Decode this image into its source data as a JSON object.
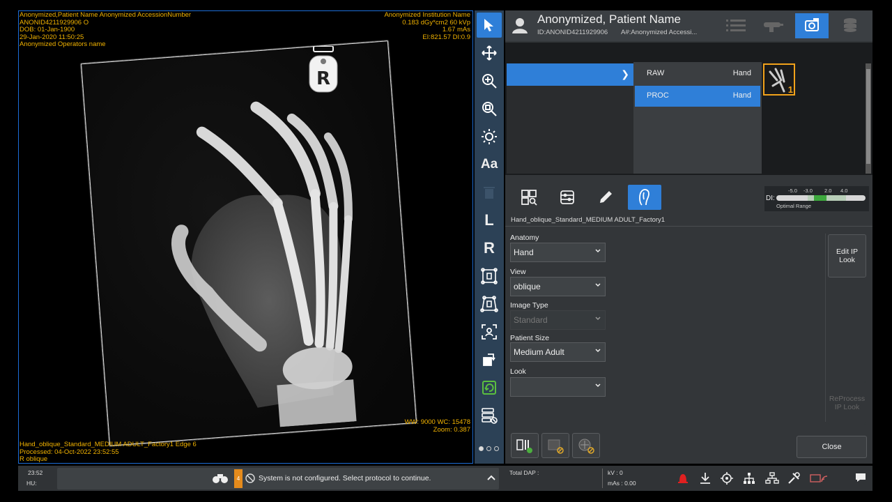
{
  "viewer": {
    "overlay_top_left": [
      "Anonymized,Patient Name Anonymized AccessionNumber",
      "ANONID4211929906 O",
      "DOB: 01-Jan-1900",
      "29-Jan-2020    11:50:25",
      "Anonymized Operators name"
    ],
    "overlay_top_right": [
      "Anonymized Institution Name",
      "0.183 dGy*cm2   60 kVp",
      "1.67 mAs",
      "EI:821.57 DI:0.9"
    ],
    "overlay_bottom_right": [
      "WW: 9000 WC: 15478",
      "Zoom: 0.387"
    ],
    "overlay_bottom_left": [
      "Hand_oblique_Standard_MEDIUM ADULT_Factory1 Edge 6",
      "Processed: 04-Oct-2022  23:52:55",
      "R oblique"
    ],
    "marker_letter": "R"
  },
  "toolstrip": {
    "tools": [
      {
        "name": "select-arrow-icon",
        "active": true
      },
      {
        "name": "pan-icon"
      },
      {
        "name": "zoom-in-icon"
      },
      {
        "name": "zoom-fit-icon"
      },
      {
        "name": "brightness-icon"
      },
      {
        "name": "annotation-text-icon",
        "label": "Aa"
      },
      {
        "name": "trash-icon"
      },
      {
        "name": "left-marker-icon",
        "label": "L"
      },
      {
        "name": "right-marker-icon",
        "label": "R"
      },
      {
        "name": "crop-icon"
      },
      {
        "name": "shutter-icon"
      },
      {
        "name": "face-detect-icon"
      },
      {
        "name": "rotate-icon"
      },
      {
        "name": "reset-icon"
      },
      {
        "name": "send-icon"
      }
    ]
  },
  "patient": {
    "name": "Anonymized, Patient Name",
    "id": "ID:ANONID4211929906",
    "accession": "A#:Anonymized Accessi..."
  },
  "header_buttons": [
    "worklist-icon",
    "tube-icon",
    "image-viewer-icon",
    "database-icon"
  ],
  "series": {
    "rows": [
      {
        "label": "RAW",
        "anatomy": "Hand",
        "selected": false
      },
      {
        "label": "PROC",
        "anatomy": "Hand",
        "selected": true
      }
    ],
    "thumbnail_count": "1"
  },
  "di_indicator": {
    "label": "DI:",
    "scale": [
      "-5.0",
      "-3.0",
      "2.0",
      "4.0"
    ],
    "optimal_label": "Optimal Range",
    "value_color": "#3da83d"
  },
  "protocol_name": "Hand_oblique_Standard_MEDIUM ADULT_Factory1",
  "fields": {
    "anatomy": {
      "label": "Anatomy",
      "value": "Hand"
    },
    "view": {
      "label": "View",
      "value": "oblique"
    },
    "image_type": {
      "label": "Image Type",
      "value": "Standard",
      "disabled": true
    },
    "patient_size": {
      "label": "Patient Size",
      "value": "Medium Adult"
    },
    "look": {
      "label": "Look",
      "value": ""
    }
  },
  "buttons": {
    "edit_ip_look": "Edit IP Look",
    "reprocess_ip_look": "ReProcess IP Look",
    "close": "Close"
  },
  "statusbar": {
    "time": "23:52",
    "hu": "HU:",
    "message_count": "4",
    "message": "System is not configured. Select protocol to continue.",
    "total_dap": "Total DAP :",
    "kv": "kV : 0",
    "mas": "mAs : 0.00"
  },
  "colors": {
    "accent": "#2f7fd8",
    "overlay_text": "#f2b300",
    "warning": "#e58b1c",
    "alarm": "#e02020"
  }
}
